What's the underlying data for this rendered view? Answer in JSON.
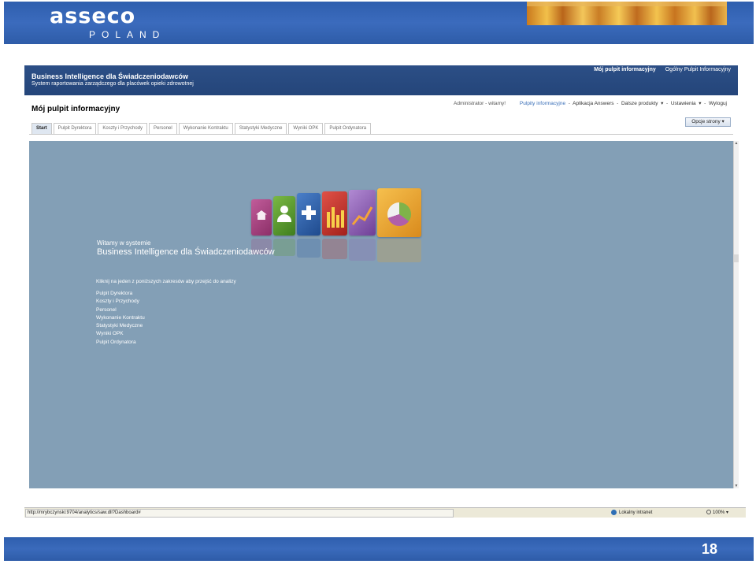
{
  "slide": {
    "logo_text": "asseco",
    "logo_sub": "POLAND",
    "page_number": "18"
  },
  "app": {
    "title": "Business Intelligence dla Świadczeniodawców",
    "subtitle": "System raportowania zarządczego dla placówek opieki zdrowotnej",
    "top_links": [
      "Mój pulpit informacyjny",
      "Ogólny Pulpit Informacyjny"
    ],
    "page_title": "Mój pulpit informacyjny",
    "user_nav": {
      "welcome": "Administrator - witamy!",
      "items": [
        "Pulpity informacyjne",
        "Aplikacja Answers",
        "Dalsze produkty",
        "Ustawienia",
        "Wyloguj"
      ]
    },
    "page_options": "Opcje strony",
    "tabs": [
      "Start",
      "Pulpit Dyrektora",
      "Koszty i Przychody",
      "Personel",
      "Wykonanie Kontraktu",
      "Statystyki Medyczne",
      "Wyniki OPK",
      "Pulpit Ordynatora"
    ],
    "active_tab": "Start",
    "welcome_line1": "Witamy w systemie",
    "welcome_line2": "Business Intelligence dla Świadczeniodawców",
    "instruction": "Kliknij na jeden z poniższych zakresów aby przejść do analizy",
    "links": [
      "Pulpit Dyrektora",
      "Koszty i Przychody",
      "Personel",
      "Wykonanie Kontraktu",
      "Statystyki Medyczne",
      "Wyniki OPK",
      "Pulpit Ordynatora"
    ],
    "content_bg": "#839fb6",
    "banner_color": "#24457a"
  },
  "icons": [
    "home-icon",
    "people-icon",
    "medical-cross-icon",
    "bar-chart-icon",
    "line-chart-icon",
    "pie-chart-icon"
  ],
  "status_bar": {
    "url": "http://mrybczynski:9704/analytics/saw.dll?Dashboard#",
    "zone": "Lokalny intranet",
    "zoom": "100%"
  }
}
